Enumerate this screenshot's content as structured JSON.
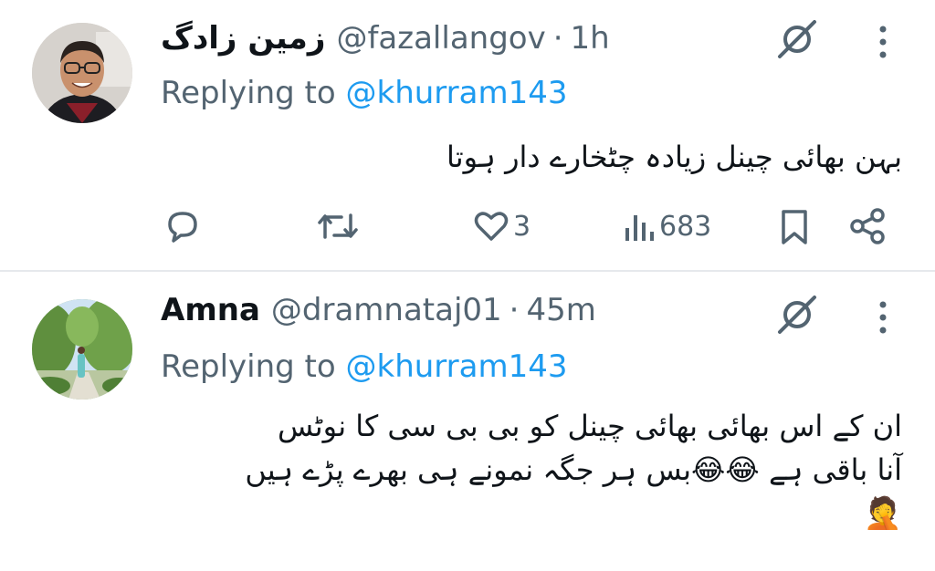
{
  "tweets": [
    {
      "display_name": "زمین زادگ",
      "handle": "@fazallangov",
      "separator": "·",
      "time": "1h",
      "replying_prefix": "Replying to",
      "replying_to": "@khurram143",
      "text": "بہن بھائی  چینل زیادہ چٹخارے دار ہوتا",
      "likes": "3",
      "views": "683"
    },
    {
      "display_name": "Amna",
      "handle": "@dramnataj01",
      "separator": "·",
      "time": "45m",
      "replying_prefix": "Replying to",
      "replying_to": "@khurram143",
      "text_line1": "ان کے اس بھائی بھائی چینل کو بی بی سی کا نوٹس",
      "text_line2": "آنا باقی ہے 😂😂بس ہر جگہ نمونے ہی بھرے پڑے ہیں",
      "text_line3": "🤦"
    }
  ],
  "icons": {
    "grok": "grok-icon",
    "more": "more-vertical-icon",
    "reply": "reply-bubble-icon",
    "retweet": "retweet-icon",
    "like": "heart-icon",
    "views": "views-bar-chart-icon",
    "bookmark": "bookmark-icon",
    "share": "share-icon"
  },
  "colors": {
    "accent": "#1d9bf0",
    "secondary_text": "#536471",
    "primary_text": "#0f1419",
    "divider": "#e6e9ec"
  }
}
